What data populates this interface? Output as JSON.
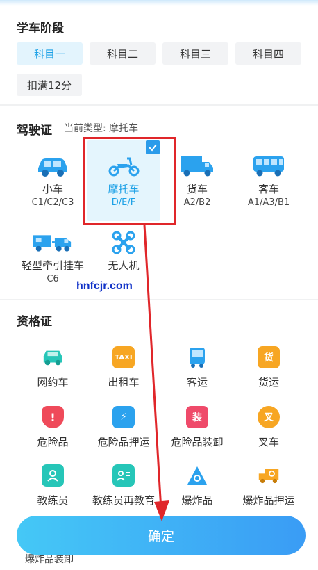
{
  "stage": {
    "title": "学车阶段",
    "options": [
      {
        "label": "科目一",
        "active": true
      },
      {
        "label": "科目二",
        "active": false
      },
      {
        "label": "科目三",
        "active": false
      },
      {
        "label": "科目四",
        "active": false
      },
      {
        "label": "扣满12分",
        "active": false
      }
    ]
  },
  "license": {
    "title": "驾驶证",
    "current_prefix": "当前类型:",
    "current_value": "摩托车",
    "items": [
      {
        "name": "小车",
        "sub": "C1/C2/C3",
        "icon": "car-icon",
        "selected": false
      },
      {
        "name": "摩托车",
        "sub": "D/E/F",
        "icon": "motorcycle-icon",
        "selected": true
      },
      {
        "name": "货车",
        "sub": "A2/B2",
        "icon": "truck-icon",
        "selected": false
      },
      {
        "name": "客车",
        "sub": "A1/A3/B1",
        "icon": "bus-icon",
        "selected": false
      },
      {
        "name": "轻型牵引挂车",
        "sub": "C6",
        "icon": "trailer-icon",
        "selected": false
      },
      {
        "name": "无人机",
        "sub": "",
        "icon": "drone-icon",
        "selected": false
      }
    ]
  },
  "watermark": "hnfcjr.com",
  "qualification": {
    "title": "资格证",
    "items": [
      {
        "name": "网约车",
        "icon": "ride-hailing-icon",
        "badge": ""
      },
      {
        "name": "出租车",
        "icon": "taxi-icon",
        "badge": "TAXI"
      },
      {
        "name": "客运",
        "icon": "passenger-bus-icon",
        "badge": ""
      },
      {
        "name": "货运",
        "icon": "freight-icon",
        "badge": "货"
      },
      {
        "name": "危险品",
        "icon": "hazard-icon",
        "badge": "!"
      },
      {
        "name": "危险品押运",
        "icon": "escort-icon",
        "badge": "⚡"
      },
      {
        "name": "危险品装卸",
        "icon": "loading-icon",
        "badge": "装"
      },
      {
        "name": "叉车",
        "icon": "forklift-icon",
        "badge": "叉"
      },
      {
        "name": "教练员",
        "icon": "coach-icon",
        "badge": ""
      },
      {
        "name": "教练员再教育",
        "icon": "coach-reedu-icon",
        "badge": ""
      },
      {
        "name": "爆炸品",
        "icon": "explosive-icon",
        "badge": ""
      },
      {
        "name": "爆炸品押运",
        "icon": "explosive-escort-icon",
        "badge": ""
      }
    ],
    "peek": "爆炸品装卸"
  },
  "confirm_label": "确定",
  "colors": {
    "accent": "#1aa0e6",
    "highlight_border": "#e0262a",
    "arrow": "#e0262a"
  }
}
